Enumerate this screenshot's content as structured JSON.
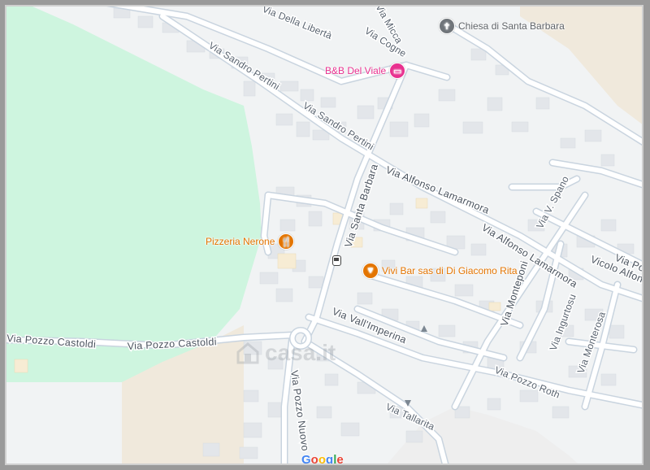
{
  "map": {
    "colors": {
      "park": "#cef5df",
      "land": "#f1f3f4",
      "sand": "#f0e9dc",
      "road": "#ffffff",
      "road_edge": "#c9d4df",
      "building": "#e3e6ea",
      "poi_orange": "#e37400",
      "poi_pink": "#e8318f",
      "poi_gray": "#70757a"
    },
    "streets": [
      "Via Della Libertà",
      "Via Micca",
      "Via Cogne",
      "Via Sandro Pertini",
      "Via Sandro Pertini",
      "Via Santa Barbara",
      "Via Alfonso Lamarmora",
      "Via Alfonso Lamarmora",
      "Via V. Spano",
      "Via Pozzo Castoldi",
      "Via Pozzo Castoldi",
      "Via Pozzo Nuovo",
      "Via Vall'Imperina",
      "Via Monteponi",
      "Vicolo Alfons",
      "Via Por",
      "Via Ingurtosu",
      "Via Monterosa",
      "Via Pozzo Roth",
      "Via Tallarita"
    ],
    "pois": [
      {
        "name": "Chiesa di Santa Barbara",
        "icon": "church-icon"
      },
      {
        "name": "B&B Del Viale",
        "icon": "hotel-bed-icon"
      },
      {
        "name": "Pizzeria Nerone",
        "icon": "restaurant-icon"
      },
      {
        "name_line1": "Vivi Bar sas di",
        "name_line2": "Di Giacomo Rita",
        "icon": "cocktail-icon"
      }
    ],
    "watermark": "casa.it",
    "logo": {
      "letters": [
        "G",
        "o",
        "o",
        "g",
        "l",
        "e"
      ],
      "colors": [
        "#4285f4",
        "#ea4335",
        "#fbbc05",
        "#4285f4",
        "#34a853",
        "#ea4335"
      ]
    }
  }
}
